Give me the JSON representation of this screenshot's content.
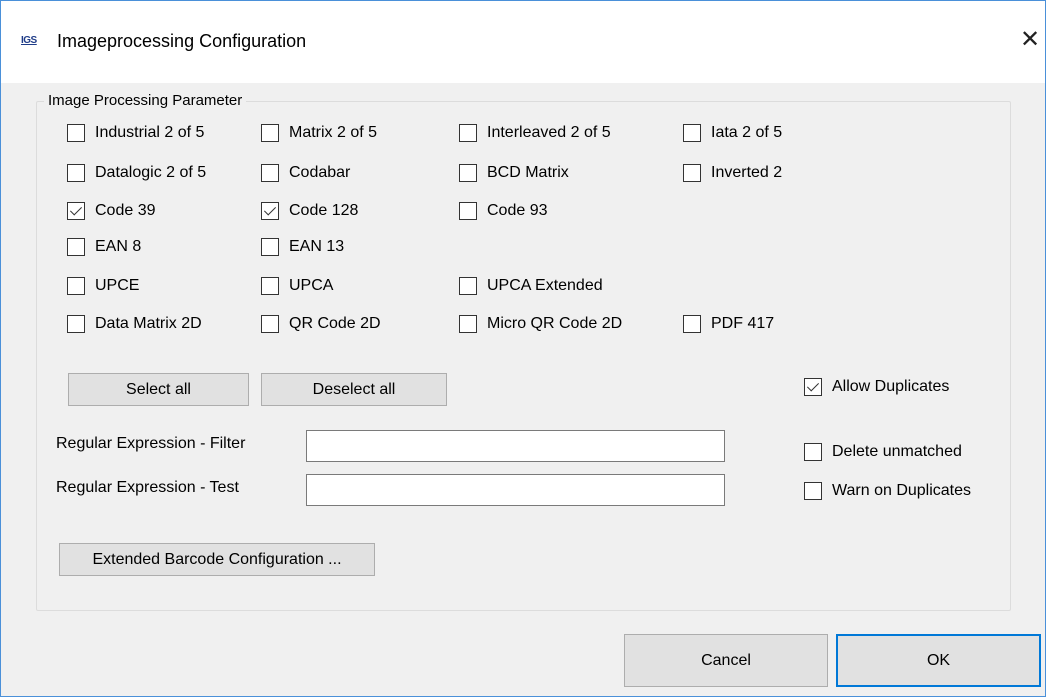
{
  "window": {
    "icon_text": "IGS",
    "title": "Imageprocessing Configuration",
    "close_glyph": "✕"
  },
  "group": {
    "legend": "Image Processing Parameter"
  },
  "barcodes": [
    {
      "label": "Industrial 2 of 5",
      "checked": false
    },
    {
      "label": "Matrix 2 of 5",
      "checked": false
    },
    {
      "label": "Interleaved 2 of 5",
      "checked": false
    },
    {
      "label": "Iata 2 of 5",
      "checked": false
    },
    {
      "label": "Datalogic 2 of 5",
      "checked": false
    },
    {
      "label": "Codabar",
      "checked": false
    },
    {
      "label": "BCD Matrix",
      "checked": false
    },
    {
      "label": "Inverted 2",
      "checked": false
    },
    {
      "label": "Code 39",
      "checked": true
    },
    {
      "label": "Code 128",
      "checked": true
    },
    {
      "label": "Code 93",
      "checked": false
    },
    {
      "label": "EAN 8",
      "checked": false
    },
    {
      "label": "EAN 13",
      "checked": false
    },
    {
      "label": "UPCE",
      "checked": false
    },
    {
      "label": "UPCA",
      "checked": false
    },
    {
      "label": "UPCA Extended",
      "checked": false
    },
    {
      "label": "Data Matrix 2D",
      "checked": false
    },
    {
      "label": "QR Code 2D",
      "checked": false
    },
    {
      "label": "Micro QR Code 2D",
      "checked": false
    },
    {
      "label": "PDF 417",
      "checked": false
    }
  ],
  "buttons": {
    "select_all": "Select all",
    "deselect_all": "Deselect all",
    "extended_config": "Extended Barcode Configuration ...",
    "cancel": "Cancel",
    "ok": "OK"
  },
  "options": [
    {
      "label": "Allow Duplicates",
      "checked": true
    },
    {
      "label": "Delete unmatched",
      "checked": false
    },
    {
      "label": "Warn on Duplicates",
      "checked": false
    }
  ],
  "regex": {
    "filter_label": "Regular Expression - Filter",
    "filter_value": "",
    "test_label": "Regular Expression - Test",
    "test_value": ""
  }
}
